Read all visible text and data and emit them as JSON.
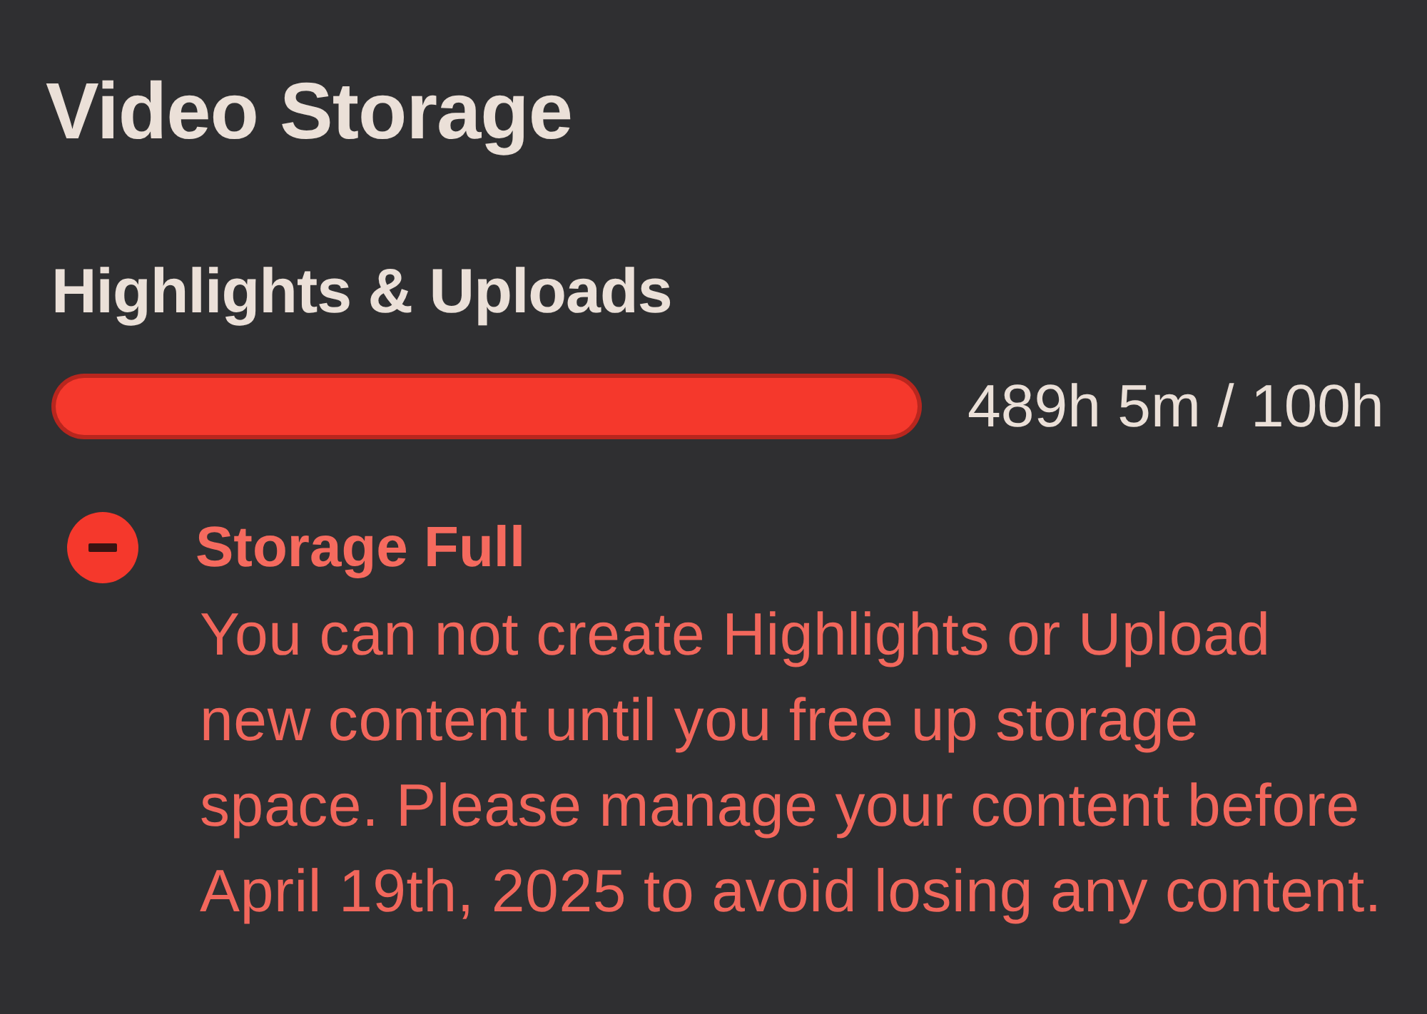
{
  "panel": {
    "title": "Video Storage"
  },
  "usage": {
    "label": "Highlights & Uploads",
    "level": 1,
    "reading": "489h 5m / 100h"
  },
  "alert": {
    "kind": "error",
    "title": "Storage Full",
    "message_lines": [
      "You can not create Highlights or Upload",
      "new content until you free up storage",
      "space. Please manage your content before",
      "April 19th, 2025 to avoid losing any content."
    ]
  }
}
